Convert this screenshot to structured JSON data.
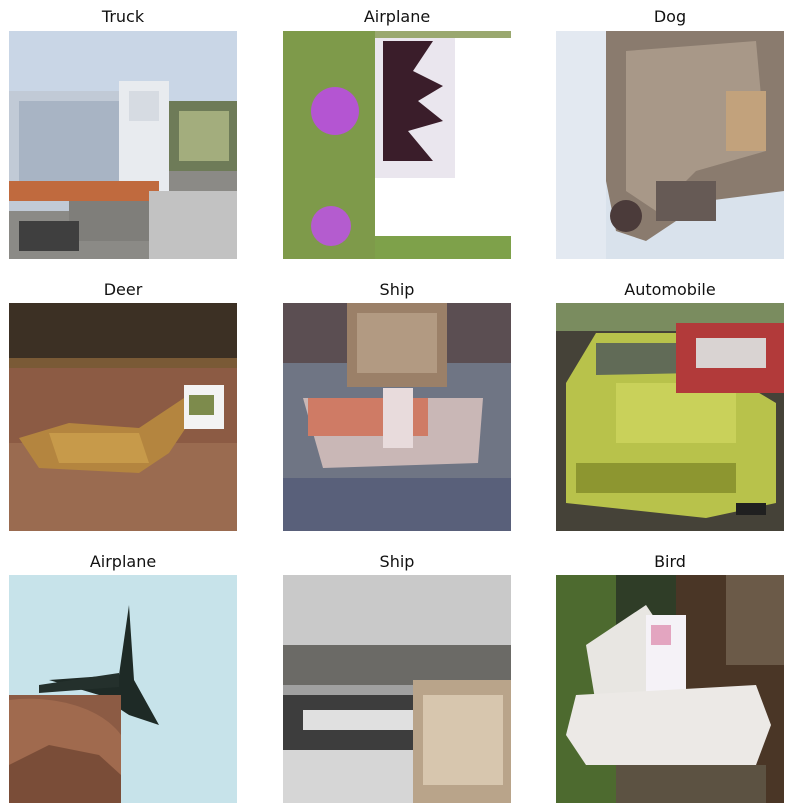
{
  "grid": {
    "tiles": [
      {
        "label": "Truck"
      },
      {
        "label": "Airplane"
      },
      {
        "label": "Dog"
      },
      {
        "label": "Deer"
      },
      {
        "label": "Ship"
      },
      {
        "label": "Automobile"
      },
      {
        "label": "Airplane"
      },
      {
        "label": "Ship"
      },
      {
        "label": "Bird"
      }
    ]
  }
}
